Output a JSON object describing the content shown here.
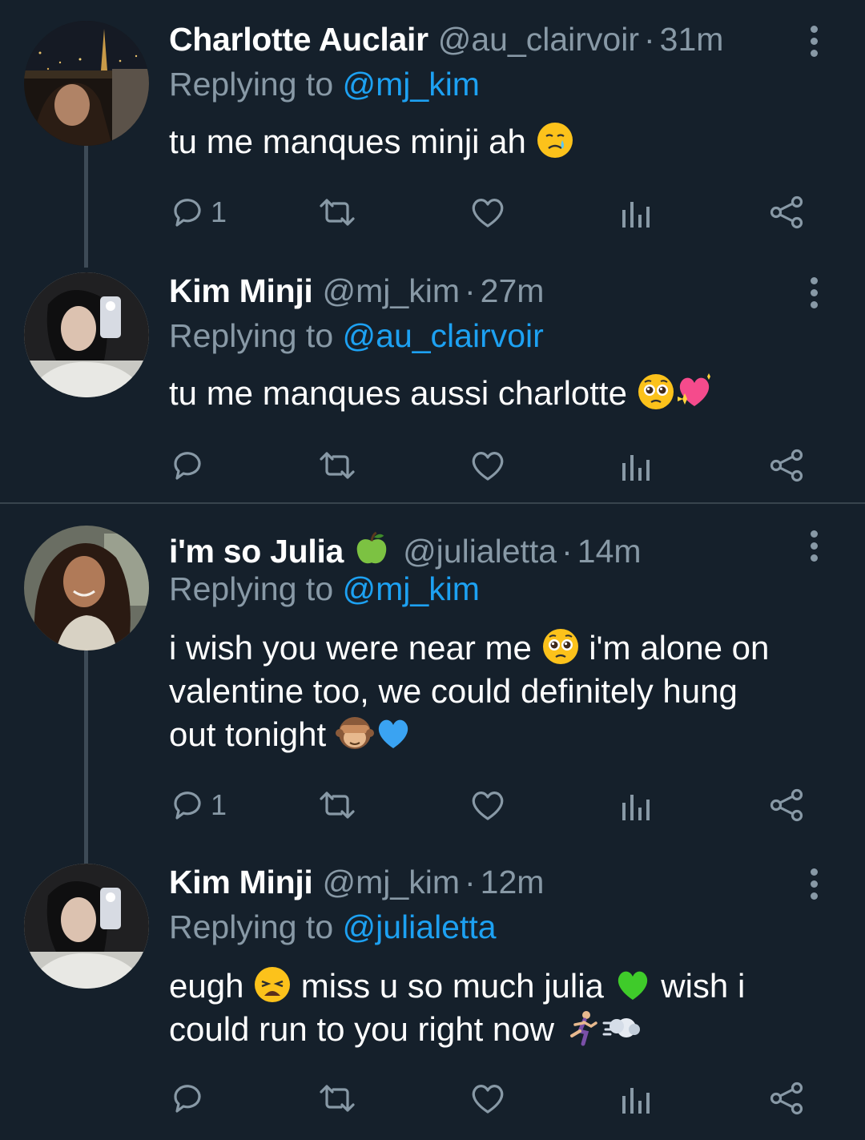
{
  "theme": {
    "background": "#15202b",
    "text": "#ffffff",
    "muted": "#8899a6",
    "link": "#1da1f2",
    "divider": "#38444d"
  },
  "tweets": [
    {
      "name": "Charlotte Auclair",
      "handle": "@au_clairvoir",
      "dot": "·",
      "time": "31m",
      "replying_prefix": "Replying to ",
      "replying_to": "@mj_kim",
      "text_lines": [
        "tu me manques minji ah"
      ],
      "emojis": [
        "crying-face-emoji"
      ],
      "reply_count": "1",
      "icons": [
        "reply-icon",
        "retweet-icon",
        "like-icon",
        "analytics-icon",
        "share-icon",
        "more-icon"
      ]
    },
    {
      "name": "Kim Minji",
      "handle": "@mj_kim",
      "dot": "·",
      "time": "27m",
      "replying_prefix": "Replying to ",
      "replying_to": "@au_clairvoir",
      "text_lines": [
        "tu me manques aussi charlotte"
      ],
      "emojis": [
        "pleading-face-emoji",
        "sparkling-heart-emoji"
      ],
      "reply_count": "",
      "icons": [
        "reply-icon",
        "retweet-icon",
        "like-icon",
        "analytics-icon",
        "share-icon",
        "more-icon"
      ]
    },
    {
      "name": "i'm so Julia",
      "name_emoji": "green-apple-emoji",
      "handle": "@julialetta",
      "dot": "·",
      "time": "14m",
      "replying_prefix": "Replying to ",
      "replying_to": "@mj_kim",
      "text_parts": [
        "i wish you were near me",
        "i'm alone on",
        "valentine too, we could definitely hung",
        "out tonight"
      ],
      "emojis": [
        "pleading-face-emoji",
        "see-no-evil-monkey-emoji",
        "blue-heart-emoji"
      ],
      "reply_count": "1",
      "icons": [
        "reply-icon",
        "retweet-icon",
        "like-icon",
        "analytics-icon",
        "share-icon",
        "more-icon"
      ]
    },
    {
      "name": "Kim Minji",
      "handle": "@mj_kim",
      "dot": "·",
      "time": "12m",
      "replying_prefix": "Replying to ",
      "replying_to": "@julialetta",
      "text_parts": [
        "eugh",
        "miss u so much julia",
        "wish i",
        "could run to you right now"
      ],
      "emojis": [
        "weary-face-emoji",
        "green-heart-emoji",
        "woman-running-emoji",
        "dashing-away-emoji"
      ],
      "reply_count": "",
      "icons": [
        "reply-icon",
        "retweet-icon",
        "like-icon",
        "analytics-icon",
        "share-icon",
        "more-icon"
      ]
    }
  ]
}
